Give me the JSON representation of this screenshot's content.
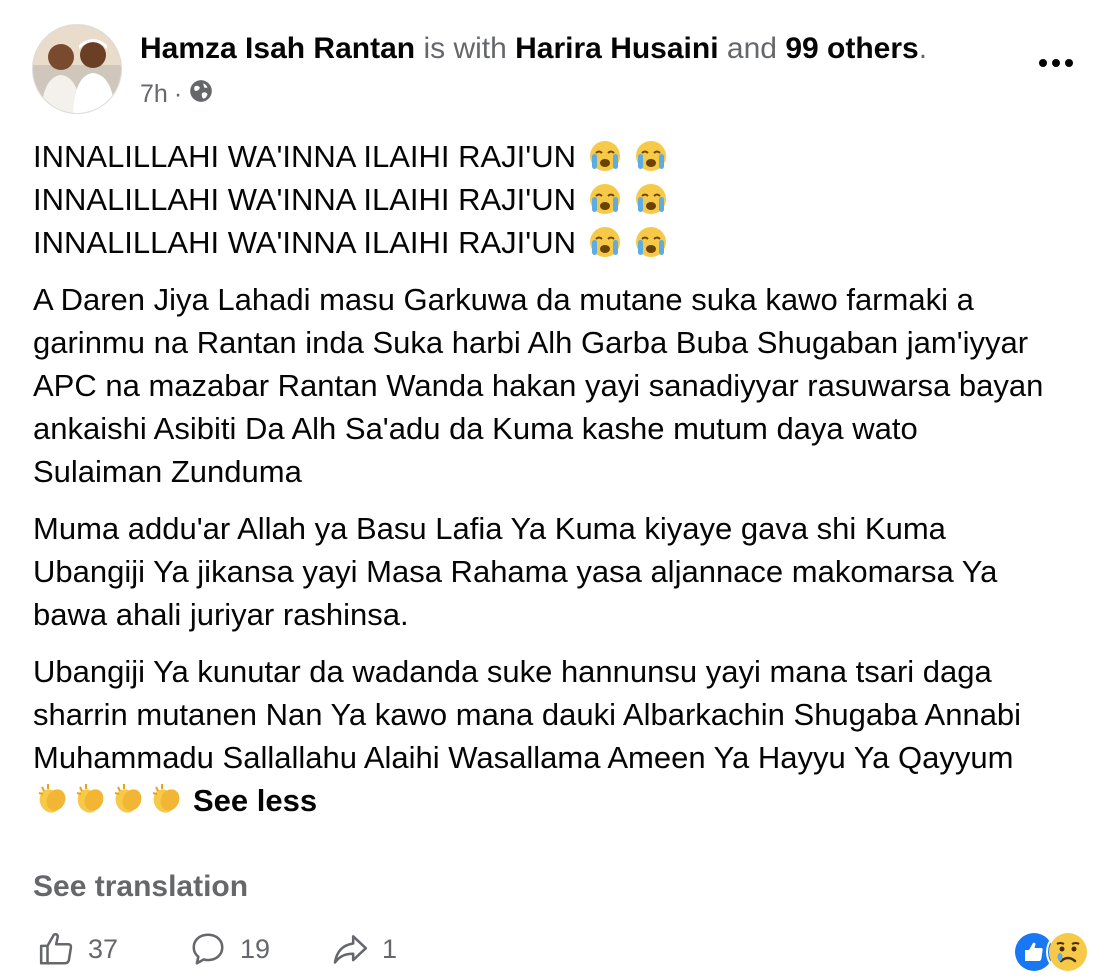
{
  "post": {
    "author": "Hamza Isah Rantan",
    "with_text": "is with",
    "tagged": "Harira Husaini",
    "and_text": "and",
    "others": "99 others",
    "period": ".",
    "time": "7h",
    "separator": "·",
    "privacy_icon": "globe-icon",
    "more_icon": "more-options-icon",
    "condolence_lines": [
      "INNALILLAHI WA'INNA ILAIHI RAJI'UN",
      "INNALILLAHI WA'INNA ILAIHI RAJI'UN",
      "INNALILLAHI WA'INNA ILAIHI RAJI'UN"
    ],
    "paragraph1_lines": [
      "A Daren Jiya Lahadi masu Garkuwa da mutane suka kawo farmaki a",
      "garinmu na Rantan inda Suka harbi Alh Garba Buba Shugaban jam'iyyar",
      "APC na mazabar Rantan Wanda hakan yayi sanadiyyar rasuwarsa bayan",
      "ankaishi Asibiti  Da Alh Sa'adu da Kuma kashe mutum daya wato",
      "Sulaiman Zunduma"
    ],
    "paragraph2_lines": [
      "Muma addu'ar Allah ya Basu Lafia Ya Kuma kiyaye gava shi Kuma",
      "Ubangiji Ya jikansa yayi Masa Rahama yasa aljannace makomarsa Ya",
      "bawa ahali juriyar rashinsa."
    ],
    "paragraph3_lines": [
      "Ubangiji Ya kunutar da wadanda suke hannunsu yayi mana tsari daga",
      "sharrin mutanen Nan Ya kawo mana dauki Albarkachin Shugaba Annabi",
      "Muhammadu Sallallahu Alaihi Wasallama Ameen Ya Hayyu Ya Qayyum"
    ],
    "see_less": "See less",
    "see_translation": "See translation"
  },
  "actions": {
    "likes": "37",
    "comments": "19",
    "shares": "1"
  },
  "colors": {
    "muted": "#65676b",
    "text": "#050505",
    "like_blue": "#1877f2",
    "emoji_yellow": "#f7c948"
  }
}
